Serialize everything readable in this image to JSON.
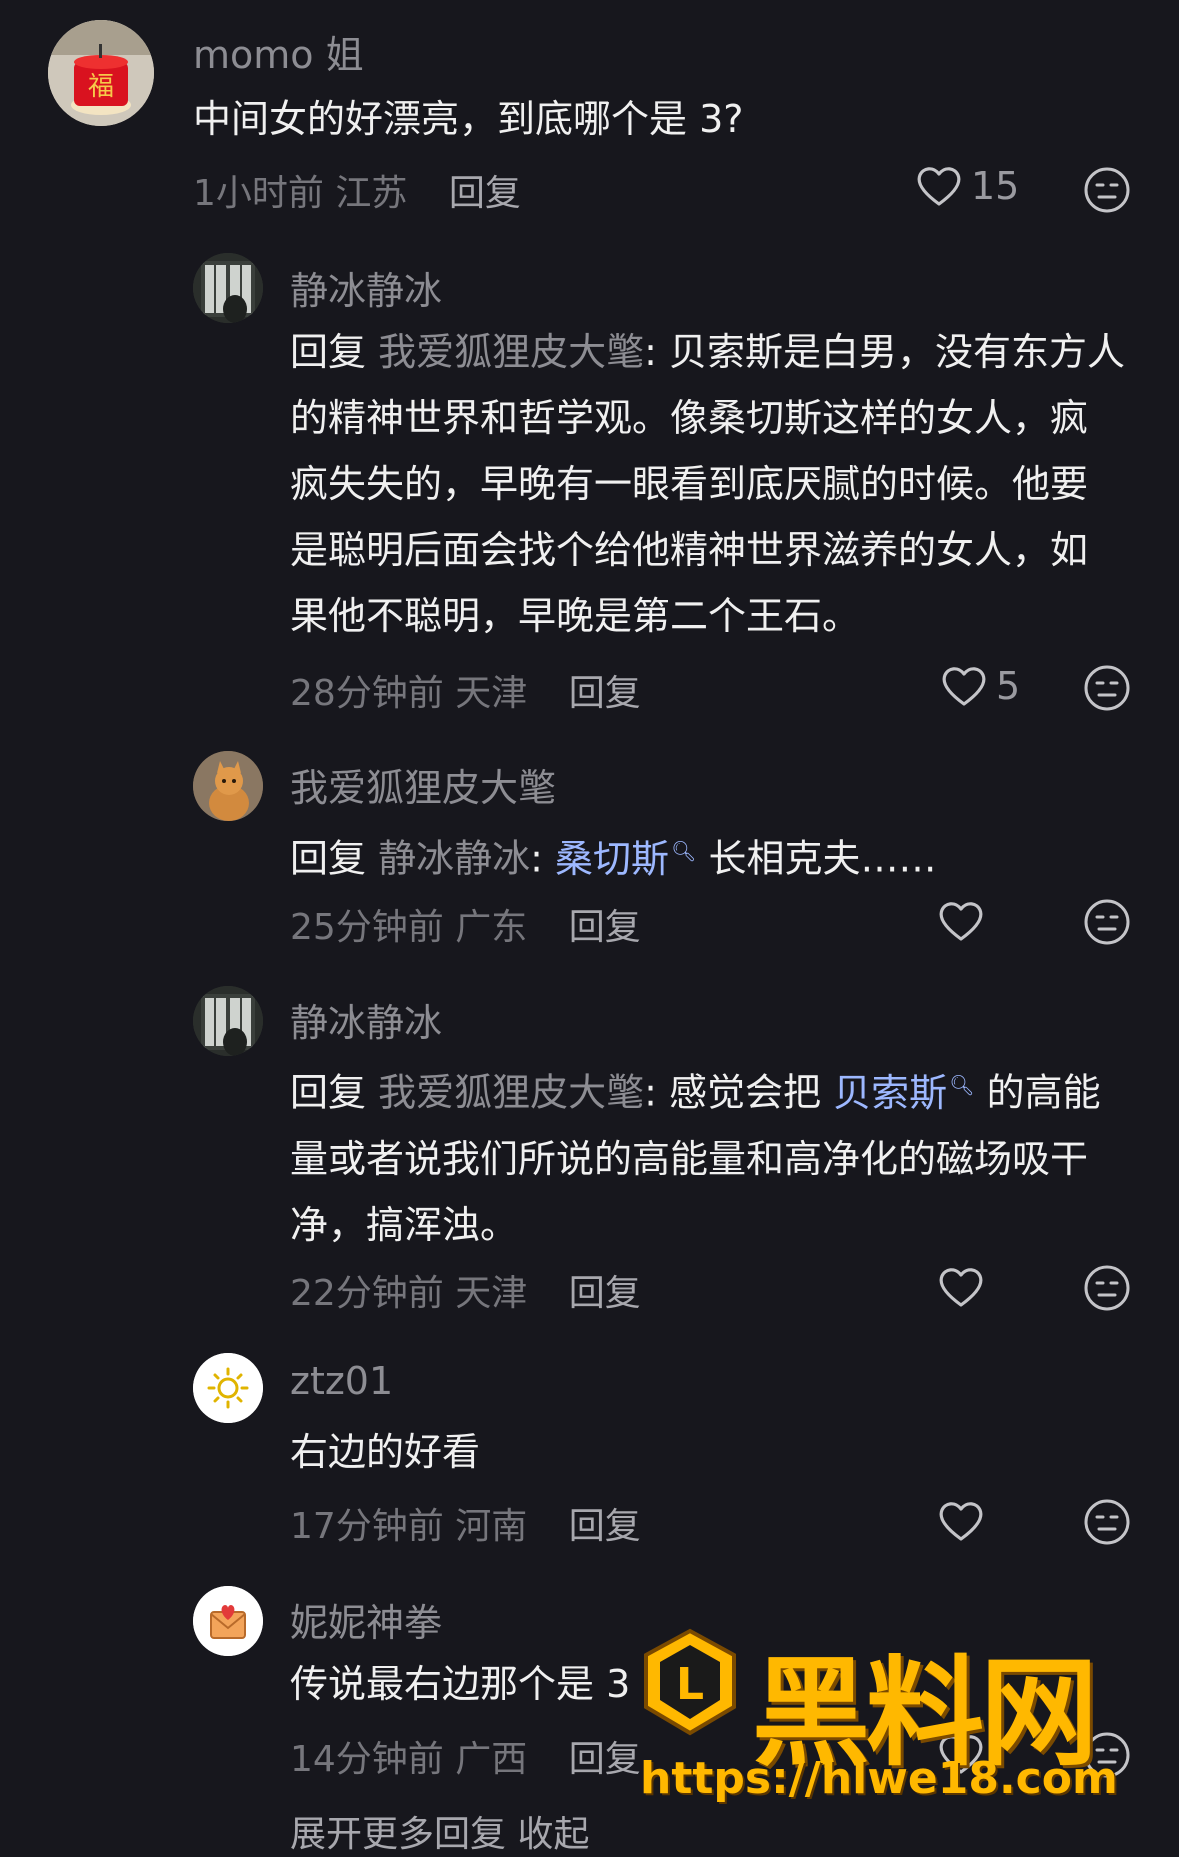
{
  "comments": [
    {
      "username": "momo 姐",
      "avatar_icon": "cake-avatar",
      "text": "中间女的好漂亮，到底哪个是 3?",
      "time": "1小时前",
      "location": "江苏",
      "reply_label": "回复",
      "likes": "15"
    },
    {
      "username": "静冰静冰",
      "avatar_icon": "window-avatar",
      "reply_prefix": "回复",
      "reply_target": "我爱狐狸皮大氅",
      "text": ": 贝索斯是白男，没有东方人的精神世界和哲学观。像桑切斯这样的女人，疯疯失失的，早晚有一眼看到底厌腻的时候。他要是聪明后面会找个给他精神世界滋养的女人，如果他不聪明，早晚是第二个王石。",
      "time": "28分钟前",
      "location": "天津",
      "reply_label": "回复",
      "likes": "5"
    },
    {
      "username": "我爱狐狸皮大氅",
      "avatar_icon": "cat-avatar",
      "reply_prefix": "回复",
      "reply_target": "静冰静冰",
      "text_before": ": ",
      "mention": "桑切斯",
      "text_after": " 长相克夫……",
      "time": "25分钟前",
      "location": "广东",
      "reply_label": "回复",
      "likes": ""
    },
    {
      "username": "静冰静冰",
      "avatar_icon": "window-avatar",
      "reply_prefix": "回复",
      "reply_target": "我爱狐狸皮大氅",
      "text_before": ": 感觉会把 ",
      "mention": "贝索斯",
      "text_after": " 的高能量或者说我们所说的高能量和高净化的磁场吸干净，搞浑浊。",
      "time": "22分钟前",
      "location": "天津",
      "reply_label": "回复",
      "likes": ""
    },
    {
      "username": "ztz01",
      "avatar_icon": "sun-avatar",
      "text": "右边的好看",
      "time": "17分钟前",
      "location": "河南",
      "reply_label": "回复",
      "likes": ""
    },
    {
      "username": "妮妮神拳",
      "avatar_icon": "envelope-heart-avatar",
      "text": "传说最右边那个是 3",
      "time": "14分钟前",
      "location": "广西",
      "reply_label": "回复",
      "likes": ""
    }
  ],
  "footer": {
    "expand_label": "展开更多回复  收起"
  },
  "watermark": {
    "title": "黑料网",
    "url": "https://hlwe18.com"
  },
  "colors": {
    "background": "#17171d",
    "mention": "#9db8ff",
    "watermark": "#ffb800"
  }
}
